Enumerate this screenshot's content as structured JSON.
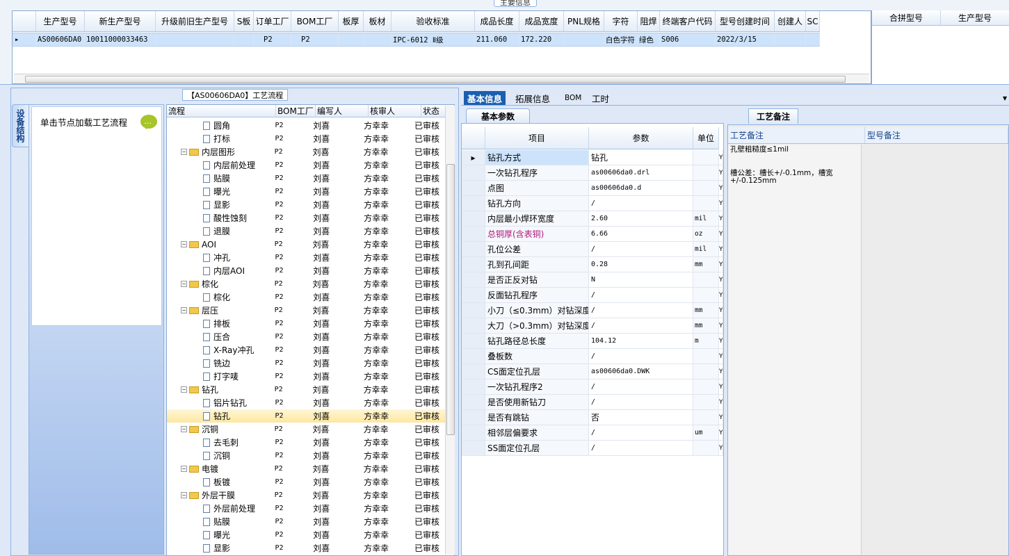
{
  "top": {
    "title": "主要信息",
    "columns": [
      "生产型号",
      "新生产型号",
      "升级前旧生产型号",
      "S板",
      "订单工厂",
      "BOM工厂",
      "板厚",
      "板材",
      "验收标准",
      "成品长度",
      "成品宽度",
      "PNL规格",
      "字符",
      "阻焊",
      "终端客户代码",
      "型号创建时间",
      "创建人",
      "SC"
    ],
    "row": [
      "AS00606DA0",
      "10011000033463",
      "",
      "",
      "P2",
      "P2",
      "",
      "",
      "IPC-6012 Ⅱ级",
      "211.060",
      "172.220",
      "",
      "白色字符",
      "绿色",
      "S006",
      "2022/3/15",
      "",
      ""
    ],
    "merge_columns": [
      "合拼型号",
      "生产型号"
    ]
  },
  "left": {
    "side_tab": "设备结构",
    "side_hint": "单击节点加载工艺流程",
    "flow_title": "【AS00606DA0】工艺流程",
    "tree_columns": [
      "流程",
      "BOM工厂",
      "编写人",
      "核审人",
      "状态"
    ],
    "rows": [
      {
        "name": "圆角",
        "level": 1,
        "type": "doc"
      },
      {
        "name": "打标",
        "level": 1,
        "type": "doc"
      },
      {
        "name": "内层图形",
        "level": 0,
        "type": "folder"
      },
      {
        "name": "内层前处理",
        "level": 1,
        "type": "doc"
      },
      {
        "name": "贴膜",
        "level": 1,
        "type": "doc"
      },
      {
        "name": "曝光",
        "level": 1,
        "type": "doc"
      },
      {
        "name": "显影",
        "level": 1,
        "type": "doc"
      },
      {
        "name": "酸性蚀刻",
        "level": 1,
        "type": "doc"
      },
      {
        "name": "退膜",
        "level": 1,
        "type": "doc"
      },
      {
        "name": "AOI",
        "level": 0,
        "type": "folder"
      },
      {
        "name": "冲孔",
        "level": 1,
        "type": "doc"
      },
      {
        "name": "内层AOI",
        "level": 1,
        "type": "doc"
      },
      {
        "name": "棕化",
        "level": 0,
        "type": "folder"
      },
      {
        "name": "棕化",
        "level": 1,
        "type": "doc"
      },
      {
        "name": "层压",
        "level": 0,
        "type": "folder"
      },
      {
        "name": "排板",
        "level": 1,
        "type": "doc"
      },
      {
        "name": "压合",
        "level": 1,
        "type": "doc"
      },
      {
        "name": "X-Ray冲孔",
        "level": 1,
        "type": "doc"
      },
      {
        "name": "铣边",
        "level": 1,
        "type": "doc"
      },
      {
        "name": "打字唛",
        "level": 1,
        "type": "doc"
      },
      {
        "name": "钻孔",
        "level": 0,
        "type": "folder"
      },
      {
        "name": "铝片钻孔",
        "level": 1,
        "type": "doc"
      },
      {
        "name": "钻孔",
        "level": 1,
        "type": "doc",
        "selected": true
      },
      {
        "name": "沉铜",
        "level": 0,
        "type": "folder"
      },
      {
        "name": "去毛刺",
        "level": 1,
        "type": "doc"
      },
      {
        "name": "沉铜",
        "level": 1,
        "type": "doc"
      },
      {
        "name": "电镀",
        "level": 0,
        "type": "folder"
      },
      {
        "name": "板镀",
        "level": 1,
        "type": "doc"
      },
      {
        "name": "外层干膜",
        "level": 0,
        "type": "folder"
      },
      {
        "name": "外层前处理",
        "level": 1,
        "type": "doc"
      },
      {
        "name": "贴膜",
        "level": 1,
        "type": "doc"
      },
      {
        "name": "曝光",
        "level": 1,
        "type": "doc"
      },
      {
        "name": "显影",
        "level": 1,
        "type": "doc"
      }
    ],
    "bom": "P2",
    "writer": "刘喜",
    "reviewer": "方幸幸",
    "status": "已审核"
  },
  "right": {
    "tabs": [
      "基本信息",
      "拓展信息",
      "BOM",
      "工时"
    ],
    "basic_title": "基本参数",
    "param_columns": [
      "项目",
      "参数",
      "单位"
    ],
    "params": [
      {
        "k": "钻孔方式",
        "v": "钻孔",
        "u": "",
        "color": "#000"
      },
      {
        "k": "一次钻孔程序",
        "v": "as00606da0.drl",
        "u": "",
        "color": "#000"
      },
      {
        "k": "点图",
        "v": "as00606da0.d",
        "u": "",
        "color": "#000"
      },
      {
        "k": "钻孔方向",
        "v": "/",
        "u": "",
        "color": "#000"
      },
      {
        "k": "内层最小焊环宽度",
        "v": "2.60",
        "u": "mil",
        "color": "#000"
      },
      {
        "k": "总铜厚(含表铜)",
        "v": "6.66",
        "u": "oz",
        "color": "#b0187c"
      },
      {
        "k": "孔位公差",
        "v": "/",
        "u": "mil",
        "color": "#000"
      },
      {
        "k": "孔到孔间距",
        "v": "0.28",
        "u": "mm",
        "color": "#000"
      },
      {
        "k": "是否正反对钻",
        "v": "N",
        "u": "",
        "color": "#000"
      },
      {
        "k": "反面钻孔程序",
        "v": "/",
        "u": "",
        "color": "#000"
      },
      {
        "k": "小刀（≤0.3mm）对钻深度",
        "v": "/",
        "u": "mm",
        "color": "#000"
      },
      {
        "k": "大刀（>0.3mm）对钻深度",
        "v": "/",
        "u": "mm",
        "color": "#000"
      },
      {
        "k": "钻孔路径总长度",
        "v": "104.12",
        "u": "m",
        "color": "#000"
      },
      {
        "k": "叠板数",
        "v": "/",
        "u": "",
        "color": "#000"
      },
      {
        "k": "CS面定位孔层",
        "v": "as00606da0.DWK",
        "u": "",
        "color": "#000"
      },
      {
        "k": "一次钻孔程序2",
        "v": "/",
        "u": "",
        "color": "#000"
      },
      {
        "k": "是否使用新钻刀",
        "v": "/",
        "u": "",
        "color": "#000"
      },
      {
        "k": "是否有跳钻",
        "v": "否",
        "u": "",
        "color": "#000"
      },
      {
        "k": "相邻层偏要求",
        "v": "/",
        "u": "um",
        "color": "#000"
      },
      {
        "k": "SS面定位孔层",
        "v": "/",
        "u": "",
        "color": "#000"
      }
    ],
    "y_mark": "Y",
    "note_title": "工艺备注",
    "note_columns": [
      "工艺备注",
      "型号备注"
    ],
    "note_lines": [
      "孔壁粗糙度≤1mil",
      "",
      "槽公差：槽长+/-0.1mm，槽宽",
      "+/-0.125mm"
    ]
  },
  "colors": {
    "accent": "#1a5fb0",
    "selected_row": "#cde3fb",
    "tree_selected": "#fde7a0",
    "highlight_text": "#b0187c"
  }
}
